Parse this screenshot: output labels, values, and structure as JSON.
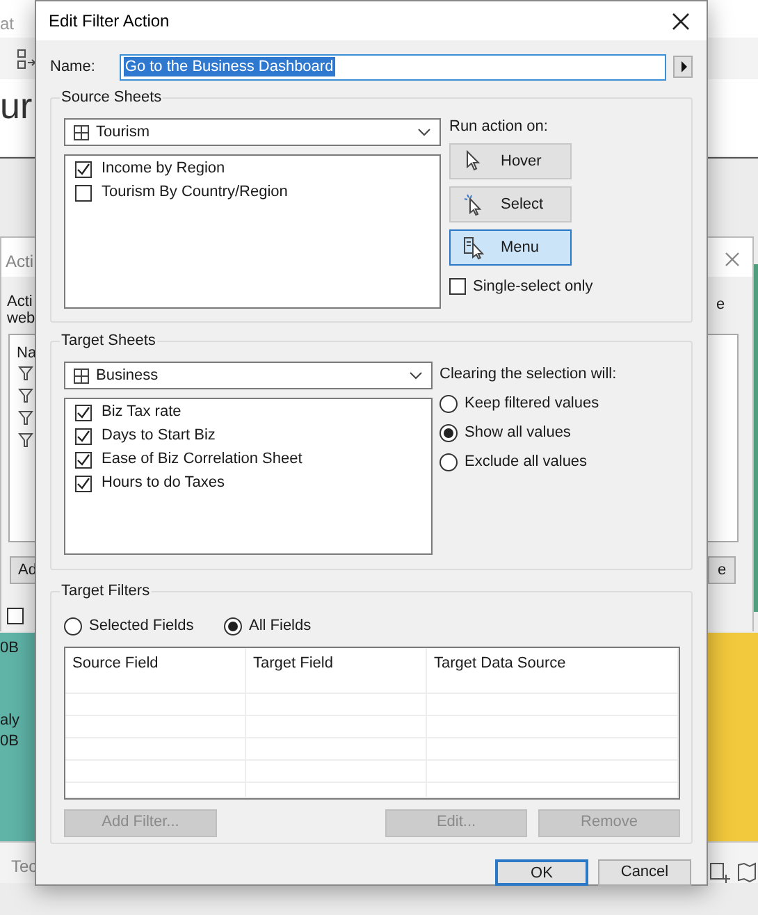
{
  "background": {
    "menu_fragment": "at",
    "heading_fragment": "ur",
    "actions_dialog": {
      "title": "Acti",
      "description_lines": [
        "Acti",
        "web"
      ],
      "list_header": "Na",
      "add_button": "Ad",
      "checkbox_checked": false,
      "right_text": "e",
      "right_button": "e"
    },
    "chart_labels": [
      "0B",
      "aly",
      "0B"
    ],
    "tab_fragment": "Tec"
  },
  "dialog": {
    "title": "Edit Filter Action",
    "name": {
      "label": "Name:",
      "value": "Go to the Business Dashboard"
    },
    "source_sheets": {
      "title": "Source Sheets",
      "dropdown": "Tourism",
      "sheets": [
        {
          "label": "Income by Region",
          "checked": true
        },
        {
          "label": "Tourism By Country/Region",
          "checked": false
        }
      ]
    },
    "run_action": {
      "title": "Run action on:",
      "options": [
        {
          "label": "Hover",
          "kind": "hover",
          "selected": false
        },
        {
          "label": "Select",
          "kind": "select",
          "selected": false
        },
        {
          "label": "Menu",
          "kind": "menu",
          "selected": true
        }
      ],
      "single_select": {
        "label": "Single-select only",
        "checked": false
      }
    },
    "target_sheets": {
      "title": "Target Sheets",
      "dropdown": "Business",
      "sheets": [
        {
          "label": "Biz Tax rate",
          "checked": true
        },
        {
          "label": "Days to Start Biz",
          "checked": true
        },
        {
          "label": "Ease of Biz Correlation Sheet",
          "checked": true
        },
        {
          "label": "Hours to do Taxes",
          "checked": true
        }
      ]
    },
    "clearing": {
      "title": "Clearing the selection will:",
      "options": [
        {
          "label": "Keep filtered values",
          "selected": false
        },
        {
          "label": "Show all values",
          "selected": true
        },
        {
          "label": "Exclude all values",
          "selected": false
        }
      ]
    },
    "target_filters": {
      "title": "Target Filters",
      "options": [
        {
          "label": "Selected Fields",
          "selected": false
        },
        {
          "label": "All Fields",
          "selected": true
        }
      ],
      "columns": [
        "Source Field",
        "Target Field",
        "Target Data Source"
      ],
      "buttons": [
        {
          "label": "Add Filter...",
          "disabled": true
        },
        {
          "label": "Edit...",
          "disabled": true
        },
        {
          "label": "Remove",
          "disabled": true
        }
      ]
    },
    "buttons": [
      {
        "label": "OK",
        "default": true
      },
      {
        "label": "Cancel",
        "default": false
      }
    ]
  }
}
